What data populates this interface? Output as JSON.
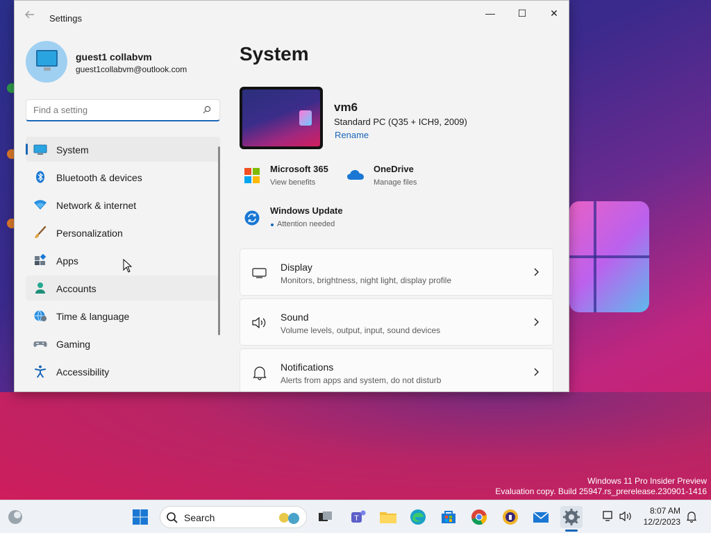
{
  "window": {
    "title": "Settings",
    "controls": {
      "minimize": "—",
      "maximize": "☐",
      "close": "✕"
    }
  },
  "profile": {
    "name": "guest1 collabvm",
    "email": "guest1collabvm@outlook.com"
  },
  "search": {
    "placeholder": "Find a setting",
    "value": ""
  },
  "nav": {
    "items": [
      {
        "label": "System",
        "icon": "monitor-icon",
        "selected": true
      },
      {
        "label": "Bluetooth & devices",
        "icon": "bluetooth-icon"
      },
      {
        "label": "Network & internet",
        "icon": "wifi-icon"
      },
      {
        "label": "Personalization",
        "icon": "brush-icon"
      },
      {
        "label": "Apps",
        "icon": "apps-icon"
      },
      {
        "label": "Accounts",
        "icon": "person-icon",
        "hover": true
      },
      {
        "label": "Time & language",
        "icon": "globe-clock-icon"
      },
      {
        "label": "Gaming",
        "icon": "gamepad-icon"
      },
      {
        "label": "Accessibility",
        "icon": "accessibility-icon"
      }
    ]
  },
  "main": {
    "title": "System",
    "device": {
      "name": "vm6",
      "model": "Standard PC (Q35 + ICH9, 2009)",
      "rename": "Rename"
    },
    "quick": [
      {
        "title": "Microsoft 365",
        "subtitle": "View benefits",
        "icon": "microsoft-365-icon"
      },
      {
        "title": "OneDrive",
        "subtitle": "Manage files",
        "icon": "onedrive-icon"
      },
      {
        "title": "Windows Update",
        "subtitle": "Attention needed",
        "icon": "windows-update-icon"
      }
    ],
    "cards": [
      {
        "title": "Display",
        "subtitle": "Monitors, brightness, night light, display profile",
        "icon": "display-icon"
      },
      {
        "title": "Sound",
        "subtitle": "Volume levels, output, input, sound devices",
        "icon": "speaker-icon"
      },
      {
        "title": "Notifications",
        "subtitle": "Alerts from apps and system, do not disturb",
        "icon": "bell-icon"
      }
    ]
  },
  "watermark": {
    "line1": "Windows 11 Pro Insider Preview",
    "line2": "Evaluation copy. Build 25947.rs_prerelease.230901-1416"
  },
  "taskbar": {
    "search_label": "Search",
    "time": "8:07 AM",
    "date": "12/2/2023"
  },
  "colors": {
    "accent": "#1a66b8",
    "window_bg": "#f3f3f3",
    "card_bg": "#fbfbfb"
  }
}
